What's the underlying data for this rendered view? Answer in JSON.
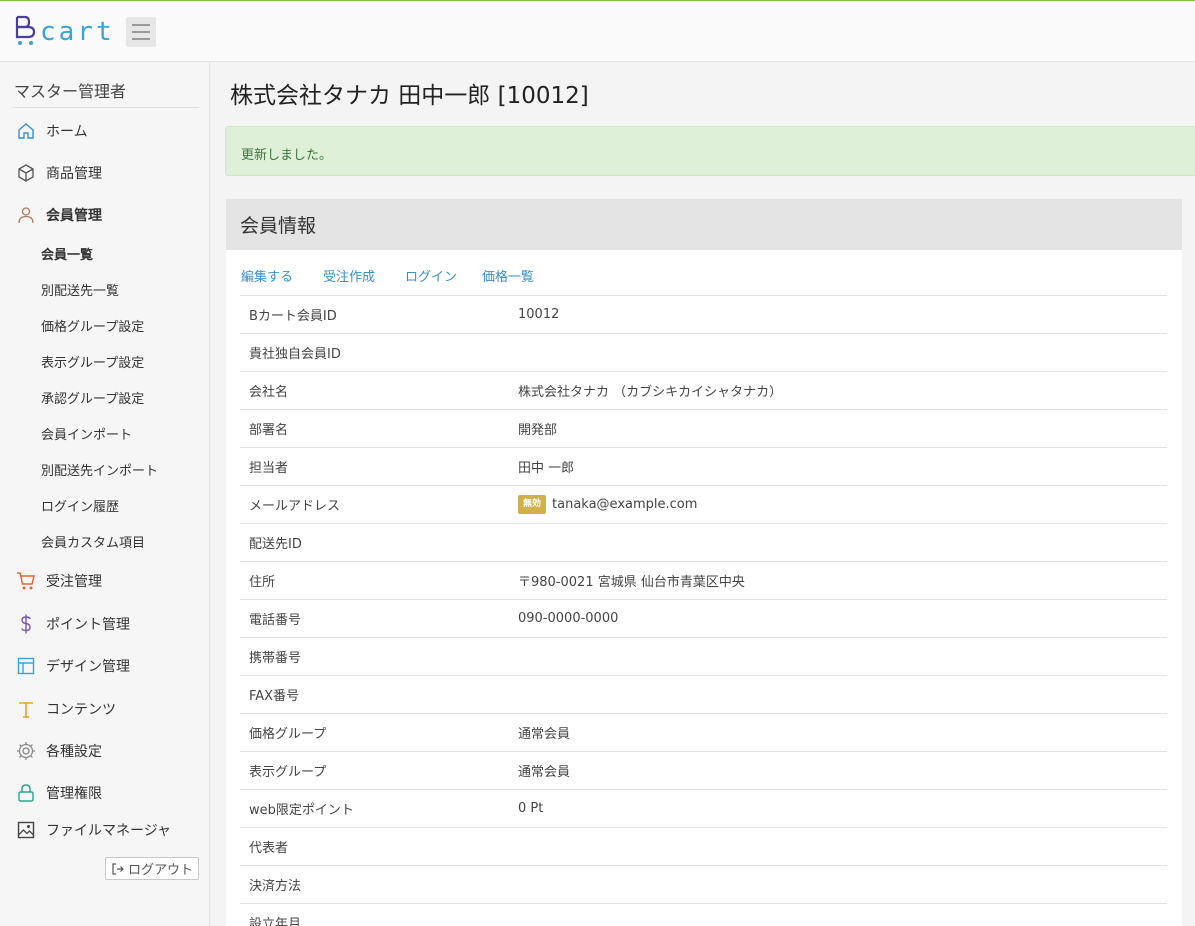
{
  "logo": {
    "text": "cart"
  },
  "sidebar": {
    "admin_name": "マスター管理者",
    "items": [
      {
        "label": "ホーム",
        "icon": "home-icon"
      },
      {
        "label": "商品管理",
        "icon": "box-icon"
      },
      {
        "label": "会員管理",
        "icon": "user-icon"
      },
      {
        "label": "受注管理",
        "icon": "cart-icon"
      },
      {
        "label": "ポイント管理",
        "icon": "dollar-icon"
      },
      {
        "label": "デザイン管理",
        "icon": "layout-icon"
      },
      {
        "label": "コンテンツ",
        "icon": "text-icon"
      },
      {
        "label": "各種設定",
        "icon": "gear-icon"
      },
      {
        "label": "管理権限",
        "icon": "lock-icon"
      },
      {
        "label": "ファイルマネージャ",
        "icon": "image-icon"
      }
    ],
    "sub_items": [
      "会員一覧",
      "別配送先一覧",
      "価格グループ設定",
      "表示グループ設定",
      "承認グループ設定",
      "会員インポート",
      "別配送先インポート",
      "ログイン履歴",
      "会員カスタム項目"
    ],
    "logout_label": "ログアウト"
  },
  "page": {
    "title": "株式会社タナカ 田中一郎 [10012]",
    "alert": "更新しました。"
  },
  "panel": {
    "title": "会員情報",
    "actions": [
      "編集する",
      "受注作成",
      "ログイン",
      "価格一覧"
    ],
    "rows": [
      {
        "label": "Bカート会員ID",
        "value": "10012"
      },
      {
        "label": "貴社独自会員ID",
        "value": ""
      },
      {
        "label": "会社名",
        "value": "株式会社タナカ （カブシキカイシャタナカ）"
      },
      {
        "label": "部署名",
        "value": "開発部"
      },
      {
        "label": "担当者",
        "value": "田中 一郎"
      },
      {
        "label": "メールアドレス",
        "badge": "無効",
        "value": "tanaka@example.com"
      },
      {
        "label": "配送先ID",
        "value": ""
      },
      {
        "label": "住所",
        "value": "〒980-0021 宮城県 仙台市青葉区中央"
      },
      {
        "label": "電話番号",
        "value": "090-0000-0000"
      },
      {
        "label": "携帯番号",
        "value": ""
      },
      {
        "label": "FAX番号",
        "value": ""
      },
      {
        "label": "価格グループ",
        "value": "通常会員"
      },
      {
        "label": "表示グループ",
        "value": "通常会員"
      },
      {
        "label": "web限定ポイント",
        "value": "0 Pt"
      },
      {
        "label": "代表者",
        "value": ""
      },
      {
        "label": "決済方法",
        "value": ""
      },
      {
        "label": "設立年月",
        "value": ""
      }
    ]
  },
  "colors": {
    "accent_green": "#7cc04b",
    "link_blue": "#3a8fc7",
    "alert_bg": "#dff0d8",
    "badge_gold": "#d2b14a"
  }
}
